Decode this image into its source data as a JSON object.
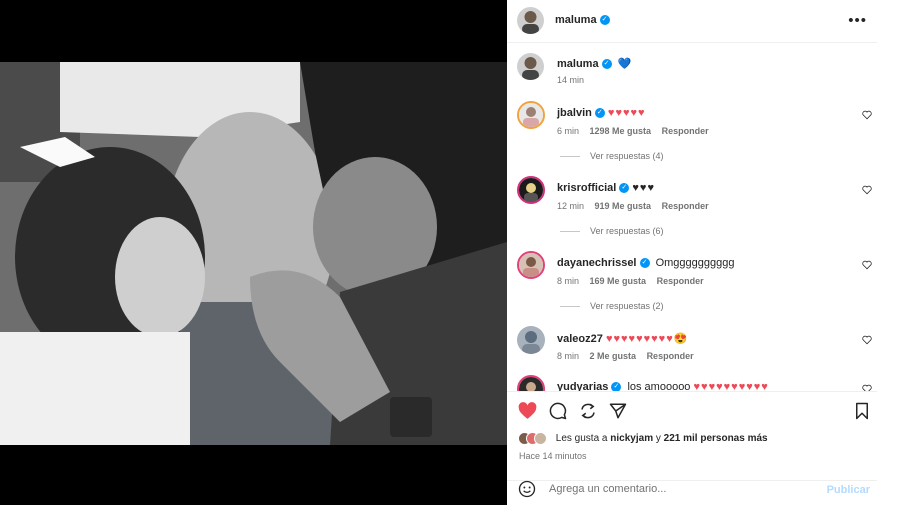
{
  "post": {
    "author": "maluma",
    "caption_time": "14 min",
    "caption_emoji": "💙"
  },
  "comments": [
    {
      "user": "jbalvin",
      "text": "",
      "emoji": "♥♥♥♥♥",
      "emoji_style": "pink",
      "time": "6 min",
      "likes": "1298 Me gusta",
      "reply": "Responder",
      "view_replies": "Ver respuestas (4)"
    },
    {
      "user": "krisrofficial",
      "text": "",
      "emoji": "♥♥♥",
      "emoji_style": "dark",
      "time": "12 min",
      "likes": "919 Me gusta",
      "reply": "Responder",
      "view_replies": "Ver respuestas (6)"
    },
    {
      "user": "dayanechrissel",
      "text": "Omgggggggggg",
      "emoji": "",
      "emoji_style": "",
      "time": "8 min",
      "likes": "169 Me gusta",
      "reply": "Responder",
      "view_replies": "Ver respuestas (2)"
    },
    {
      "user": "valeoz27",
      "text": "",
      "emoji": "♥♥♥♥♥♥♥♥♥😍",
      "emoji_style": "pink",
      "time": "8 min",
      "likes": "2 Me gusta",
      "reply": "Responder",
      "view_replies": ""
    },
    {
      "user": "yudyarias",
      "text": "los amooooo",
      "emoji": "♥♥♥♥♥♥♥♥♥♥",
      "emoji_style": "pink",
      "time": "",
      "likes": "",
      "reply": "",
      "view_replies": ""
    }
  ],
  "likes": {
    "prefix": "Les gusta a",
    "first_liker": "nickyjam",
    "connector": "y",
    "others": "221 mil personas más"
  },
  "posted": "Hace 14 minutos",
  "composer": {
    "placeholder": "Agrega un comentario...",
    "publish_label": "Publicar"
  },
  "colors": {
    "accent": "#0095f6",
    "like_red": "#ed4956",
    "publish_disabled": "#b3dbff"
  },
  "icons": [
    "more-options-icon",
    "heart-filled-icon",
    "comment-icon",
    "share-icon",
    "send-icon",
    "bookmark-icon",
    "emoji-icon",
    "heart-outline-icon",
    "verified-badge-icon"
  ]
}
